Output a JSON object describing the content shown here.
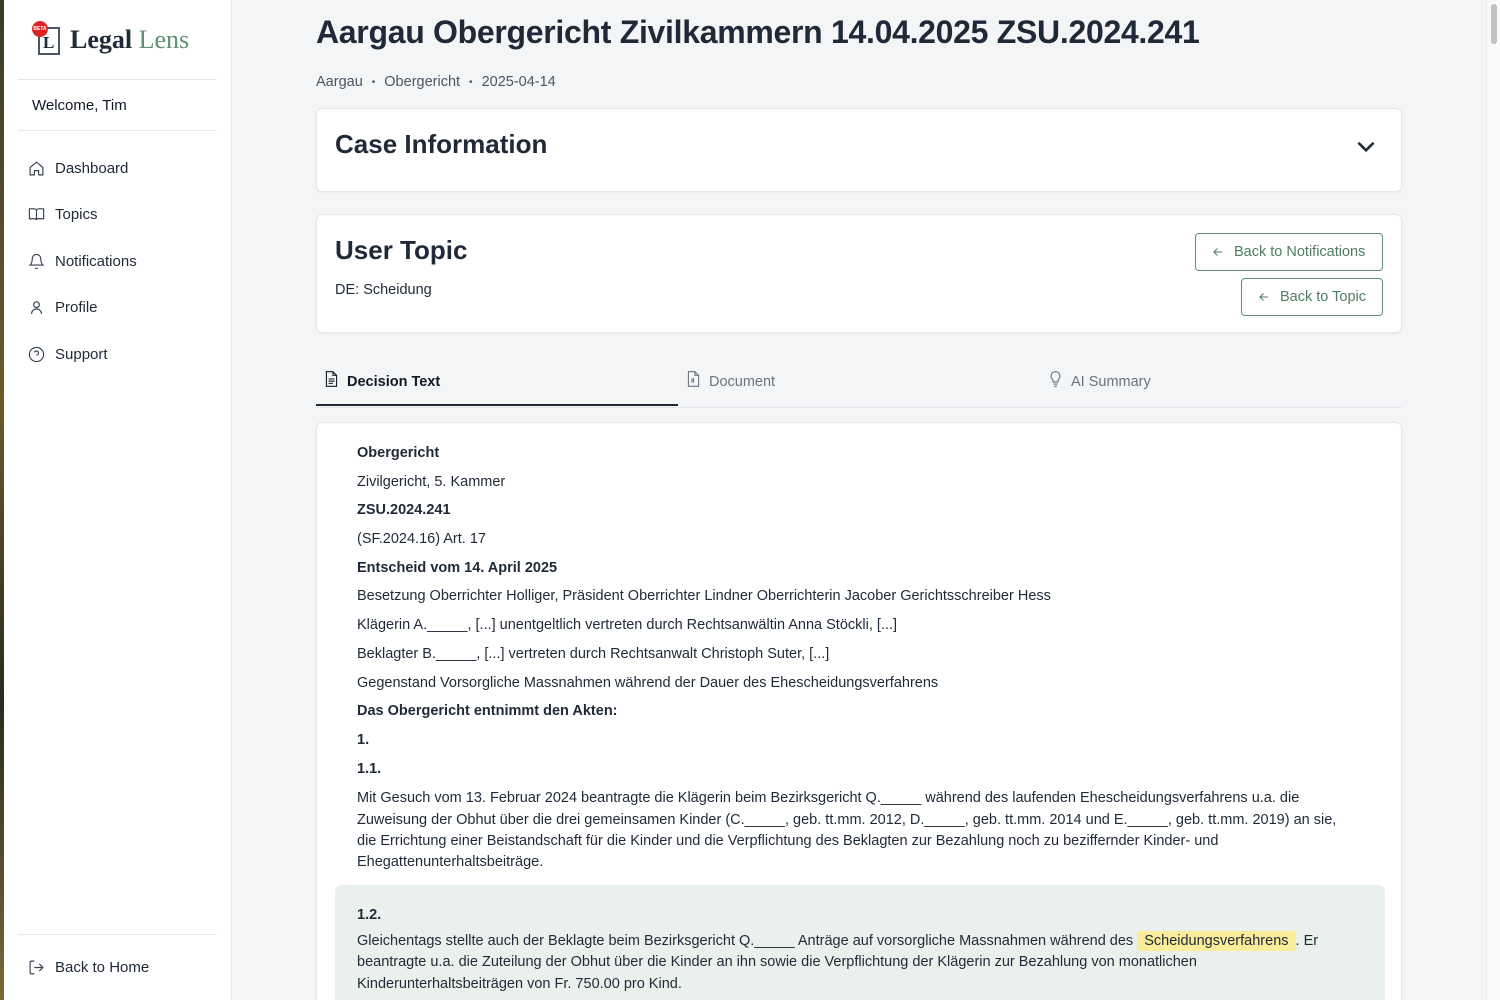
{
  "app": {
    "logo_word1": "Legal",
    "logo_word2": "Lens",
    "logo_badge": "BETA",
    "logo_letter": "L"
  },
  "sidebar": {
    "welcome": "Welcome, Tim",
    "items": [
      {
        "label": "Dashboard",
        "icon": "home-icon"
      },
      {
        "label": "Topics",
        "icon": "book-icon"
      },
      {
        "label": "Notifications",
        "icon": "bell-icon"
      },
      {
        "label": "Profile",
        "icon": "user-icon"
      },
      {
        "label": "Support",
        "icon": "help-circle-icon"
      }
    ],
    "back_home": "Back to Home"
  },
  "header": {
    "title": "Aargau Obergericht Zivilkammern 14.04.2025 ZSU.2024.241",
    "breadcrumbs": [
      "Aargau",
      "Obergericht",
      "2025-04-14"
    ]
  },
  "case_info": {
    "title": "Case Information"
  },
  "user_topic": {
    "title": "User Topic",
    "topic": "DE: Scheidung",
    "back_notifications": "Back to Notifications",
    "back_topic": "Back to Topic"
  },
  "tabs": [
    {
      "label": "Decision Text",
      "icon": "file-text-icon"
    },
    {
      "label": "Document",
      "icon": "file-icon"
    },
    {
      "label": "AI Summary",
      "icon": "lightbulb-icon"
    }
  ],
  "decision": {
    "lines": [
      "Obergericht",
      "Zivilgericht, 5. Kammer",
      "ZSU.2024.241",
      "(SF.2024.16) Art. 17",
      "Entscheid vom 14. April 2025",
      "Besetzung Oberrichter Holliger, Präsident Oberrichter Lindner Oberrichterin Jacober Gerichtsschreiber Hess",
      "Klägerin A._____, [...] unentgeltlich vertreten durch Rechtsanwältin Anna Stöckli, [...]",
      "Beklagter B._____, [...] vertreten durch Rechtsanwalt Christoph Suter, [...]",
      "Gegenstand Vorsorgliche Massnahmen während der Dauer des Ehescheidungsverfahrens",
      "Das Obergericht entnimmt den Akten:",
      "1.",
      "1.1."
    ],
    "para1": "Mit Gesuch vom 13. Februar 2024 beantragte die Klägerin beim Bezirksgericht Q._____ während des laufenden Ehescheidungsverfahrens u.a. die Zuweisung der Obhut über die drei gemeinsamen Kinder (C._____, geb. tt.mm. 2012, D._____, geb. tt.mm. 2014 und E._____, geb. tt.mm. 2019) an sie, die Errichtung einer Beistandschaft für die Kinder und die Verpflichtung des Beklagten zur Bezahlung noch zu beziffernder Kinder- und Ehegattenunterhaltsbeiträge.",
    "section_12": "1.2.",
    "para2_before": "Gleichentags stellte auch der Beklagte beim Bezirksgericht Q._____ Anträge auf vorsorgliche Massnahmen während des ",
    "para2_highlight": "Scheidungsverfahrens",
    "para2_after": ". Er beantragte u.a. die Zuteilung der Obhut über die Kinder an ihn sowie die Verpflichtung der Klägerin zur Bezahlung von monatlichen Kinderunterhaltsbeiträgen von Fr. 750.00 pro Kind."
  },
  "colors": {
    "accent": "#5e8f74",
    "highlight_block": "#eaf1ed",
    "highlight_mark": "#fbec9b",
    "beta_badge": "#dc2626"
  }
}
